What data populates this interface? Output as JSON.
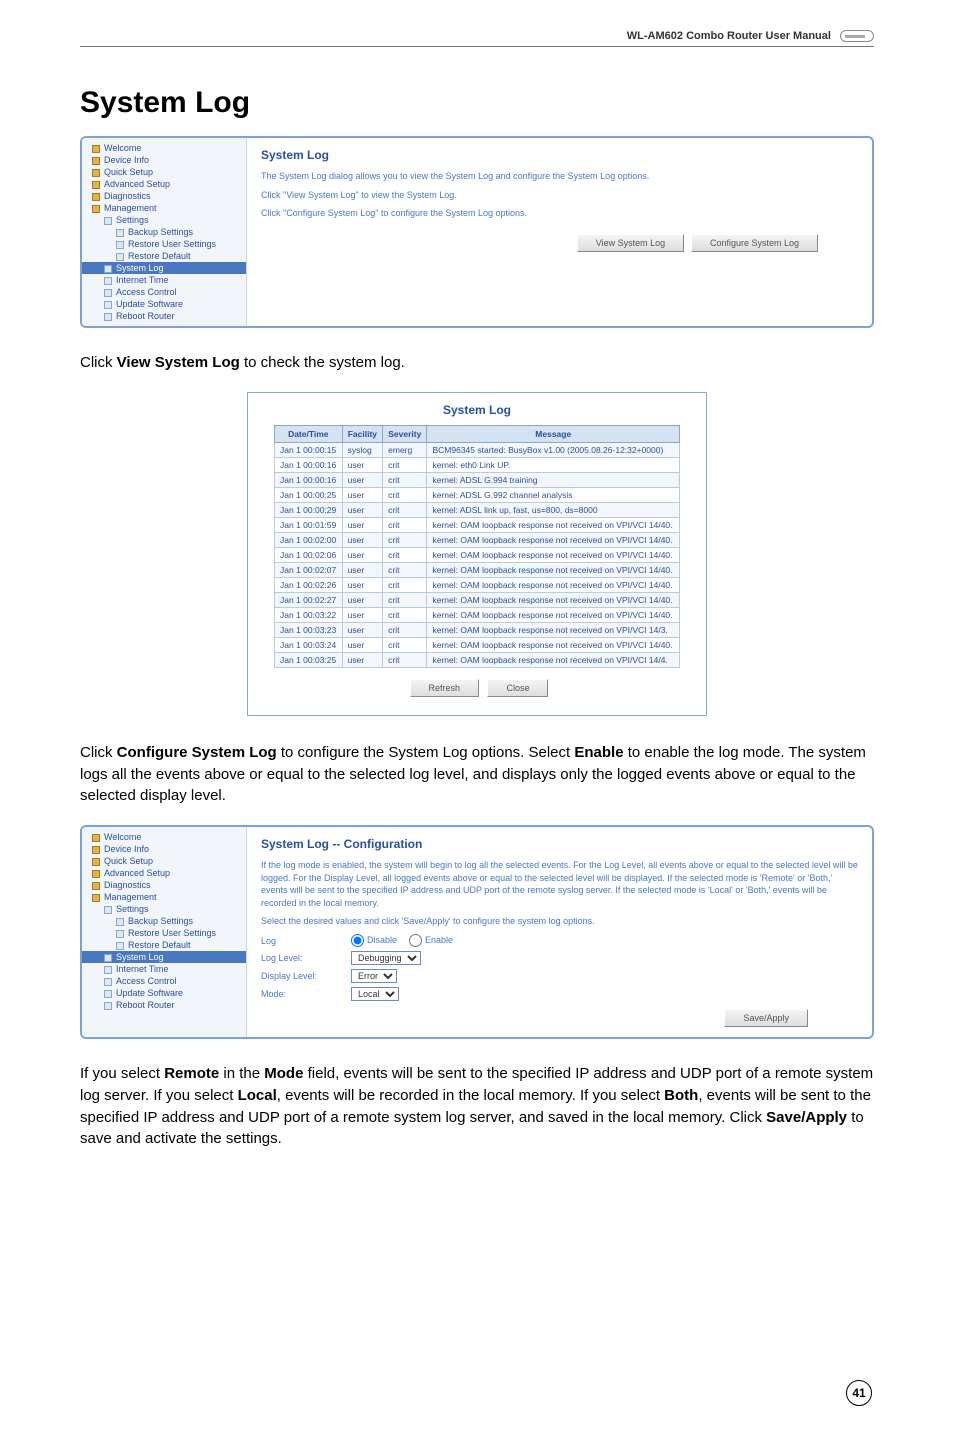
{
  "header": {
    "manual_title": "WL-AM602 Combo Router User Manual"
  },
  "title": "System Log",
  "panel1": {
    "heading": "System Log",
    "desc1": "The System Log dialog allows you to view the System Log and configure the System Log options.",
    "desc2": "Click \"View System Log\" to view the System Log.",
    "desc3": "Click \"Configure System Log\" to configure the System Log options.",
    "btn_view": "View System Log",
    "btn_cfg": "Configure System Log"
  },
  "sidebar1": {
    "items": [
      {
        "label": "Welcome",
        "cls": "item"
      },
      {
        "label": "Device Info",
        "cls": "item"
      },
      {
        "label": "Quick Setup",
        "cls": "item"
      },
      {
        "label": "Advanced Setup",
        "cls": "item"
      },
      {
        "label": "Diagnostics",
        "cls": "item"
      },
      {
        "label": "Management",
        "cls": "item"
      },
      {
        "label": "Settings",
        "cls": "item indent1"
      },
      {
        "label": "Backup Settings",
        "cls": "item indent2"
      },
      {
        "label": "Restore User Settings",
        "cls": "item indent2"
      },
      {
        "label": "Restore Default",
        "cls": "item indent2"
      },
      {
        "label": "System Log",
        "cls": "item indent1 highlight"
      },
      {
        "label": "Internet Time",
        "cls": "item indent1"
      },
      {
        "label": "Access Control",
        "cls": "item indent1"
      },
      {
        "label": "Update Software",
        "cls": "item indent1"
      },
      {
        "label": "Reboot Router",
        "cls": "item indent1"
      }
    ]
  },
  "para1_a": "Click ",
  "para1_b": "View System Log",
  "para1_c": " to check the system log.",
  "log_table": {
    "title": "System Log",
    "headers": [
      "Date/Time",
      "Facility",
      "Severity",
      "Message"
    ],
    "rows": [
      [
        "Jan 1 00:00:15",
        "syslog",
        "emerg",
        "BCM96345 started: BusyBox v1.00 (2005.08.26-12:32+0000)"
      ],
      [
        "Jan 1 00:00:16",
        "user",
        "crit",
        "kernel: eth0 Link UP."
      ],
      [
        "Jan 1 00:00:16",
        "user",
        "crit",
        "kernel: ADSL G.994 training"
      ],
      [
        "Jan 1 00:00:25",
        "user",
        "crit",
        "kernel: ADSL G.992 channel analysis"
      ],
      [
        "Jan 1 00:00:29",
        "user",
        "crit",
        "kernel: ADSL link up, fast, us=800, ds=8000"
      ],
      [
        "Jan 1 00:01:59",
        "user",
        "crit",
        "kernel: OAM loopback response not received on VPI/VCI 14/40."
      ],
      [
        "Jan 1 00:02:00",
        "user",
        "crit",
        "kernel: OAM loopback response not received on VPI/VCI 14/40."
      ],
      [
        "Jan 1 00:02:06",
        "user",
        "crit",
        "kernel: OAM loopback response not received on VPI/VCI 14/40."
      ],
      [
        "Jan 1 00:02:07",
        "user",
        "crit",
        "kernel: OAM loopback response not received on VPI/VCI 14/40."
      ],
      [
        "Jan 1 00:02:26",
        "user",
        "crit",
        "kernel: OAM loopback response not received on VPI/VCI 14/40."
      ],
      [
        "Jan 1 00:02:27",
        "user",
        "crit",
        "kernel: OAM loopback response not received on VPI/VCI 14/40."
      ],
      [
        "Jan 1 00:03:22",
        "user",
        "crit",
        "kernel: OAM loopback response not received on VPI/VCI 14/40."
      ],
      [
        "Jan 1 00:03:23",
        "user",
        "crit",
        "kernel: OAM loopback response not received on VPI/VCI 14/3."
      ],
      [
        "Jan 1 00:03:24",
        "user",
        "crit",
        "kernel: OAM loopback response not received on VPI/VCI 14/40."
      ],
      [
        "Jan 1 00:03:25",
        "user",
        "crit",
        "kernel: OAM loopback response not received on VPI/VCI 14/4."
      ]
    ],
    "btn_refresh": "Refresh",
    "btn_close": "Close"
  },
  "para2_a": "Click ",
  "para2_b": "Configure System Log",
  "para2_c": " to configure the System Log options. Select ",
  "para2_d": "Enable",
  "para2_e": " to enable the log mode. The system logs all the events above or equal to the selected log level, and displays only the logged events above or equal to the selected display level.",
  "panel2": {
    "heading": "System Log -- Configuration",
    "desc": "If the log mode is enabled, the system will begin to log all the selected events. For the Log Level, all events above or equal to the selected level will be logged. For the Display Level, all logged events above or equal to the selected level will be displayed. If the selected mode is 'Remote' or 'Both,' events will be sent to the specified IP address and UDP port of the remote syslog server. If the selected mode is 'Local' or 'Both,' events will be recorded in the local memory.",
    "desc2": "Select the desired values and click 'Save/Apply' to configure the system log options.",
    "log_label": "Log",
    "radio_disable": "Disable",
    "radio_enable": "Enable",
    "loglevel_label": "Log Level:",
    "loglevel_value": "Debugging",
    "displevel_label": "Display Level:",
    "displevel_value": "Error",
    "mode_label": "Mode:",
    "mode_value": "Local",
    "btn_save": "Save/Apply"
  },
  "para3_a": "If you select ",
  "para3_b": "Remote",
  "para3_c": " in the ",
  "para3_d": "Mode",
  "para3_e": " field, events will be sent to the specified IP address and UDP port of a remote system log server. If you select ",
  "para3_f": "Local",
  "para3_g": ", events will be recorded in the local memory. If you select ",
  "para3_h": "Both",
  "para3_i": ", events will be sent to the specified IP address and UDP port of a remote system log server, and saved in the local memory. Click ",
  "para3_j": "Save/Apply",
  "para3_k": " to save and activate the settings.",
  "page_number": "41"
}
